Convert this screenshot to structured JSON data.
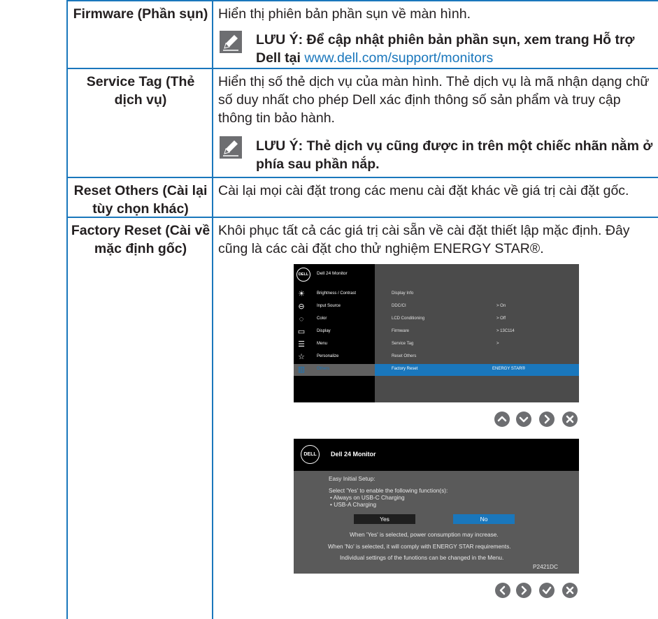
{
  "rows": [
    {
      "label": "Firmware (Phần sụn)",
      "description": "Hiển thị phiên bản phần sụn về màn hình.",
      "note": "LƯU Ý: Để cập nhật phiên bản phần sụn, xem trang Hỗ trợ Dell tại",
      "note_link": "www.dell.com/support/monitors"
    },
    {
      "label": "Service Tag (Thẻ dịch vụ)",
      "description": "Hiển thị số thẻ dịch vụ của màn hình. Thẻ dịch vụ là mã nhận dạng chữ số duy nhất cho phép Dell xác định thông số sản phẩm và truy cập thông tin bảo hành.",
      "note": "LƯU Ý: Thẻ dịch vụ cũng được in trên một chiếc nhãn nằm ở phía sau phần nắp."
    },
    {
      "label": "Reset Others (Cài lại tùy chọn khác)",
      "description": "Cài lại mọi cài đặt trong các menu cài đặt khác về giá trị cài đặt gốc."
    },
    {
      "label": "Factory Reset (Cài về mặc định gốc)",
      "description": "Khôi phục tất cả các giá trị cài sẵn về cài đặt thiết lập mặc định. Đây cũng là các cài đặt cho thử nghiệm ENERGY STAR®."
    }
  ],
  "osd_menu": {
    "logo": "DELL",
    "title": "Dell 24 Monitor",
    "menu_items": [
      {
        "label": "Brightness / Contrast",
        "icon": "sun-icon"
      },
      {
        "label": "Input Source",
        "icon": "input-icon"
      },
      {
        "label": "Color",
        "icon": "palette-icon"
      },
      {
        "label": "Display",
        "icon": "display-icon"
      },
      {
        "label": "Menu",
        "icon": "menu-icon"
      },
      {
        "label": "Personalize",
        "icon": "star-icon"
      },
      {
        "label": "Others",
        "icon": "others-icon"
      }
    ],
    "settings": [
      {
        "label": "Display Info",
        "value": ""
      },
      {
        "label": "DDC/CI",
        "value": ">   On"
      },
      {
        "label": "LCD Conditioning",
        "value": ">   Off"
      },
      {
        "label": "Firmware",
        "value": ">   13C114"
      },
      {
        "label": "Service Tag",
        "value": ">"
      },
      {
        "label": "Reset Others",
        "value": ""
      },
      {
        "label": "Factory Reset",
        "value": "ENERGY STAR®"
      }
    ],
    "nav_icons": [
      "up-icon",
      "down-icon",
      "right-icon",
      "close-icon"
    ]
  },
  "osd_dialog": {
    "logo": "DELL",
    "title": "Dell 24 Monitor",
    "heading": "Easy Initial Setup:",
    "prompt": "Select 'Yes' to enable the following function(s):",
    "bullets": [
      "• Always on USB-C Charging",
      "• USB-A Charging"
    ],
    "yes_label": "Yes",
    "no_label": "No",
    "info_lines": [
      "When 'Yes' is selected, power consumption may increase.",
      "When 'No' is selected, it will comply with ENERGY STAR requirements.",
      "Individual settings of the funotions can be changed in the Menu."
    ],
    "model": "P2421DC",
    "nav_icons": [
      "left-icon",
      "right-icon",
      "check-icon",
      "close-icon"
    ]
  },
  "colors": {
    "accent": "#1a77bc",
    "osd_bg": "#4b4b4b",
    "text": "#231f20"
  }
}
